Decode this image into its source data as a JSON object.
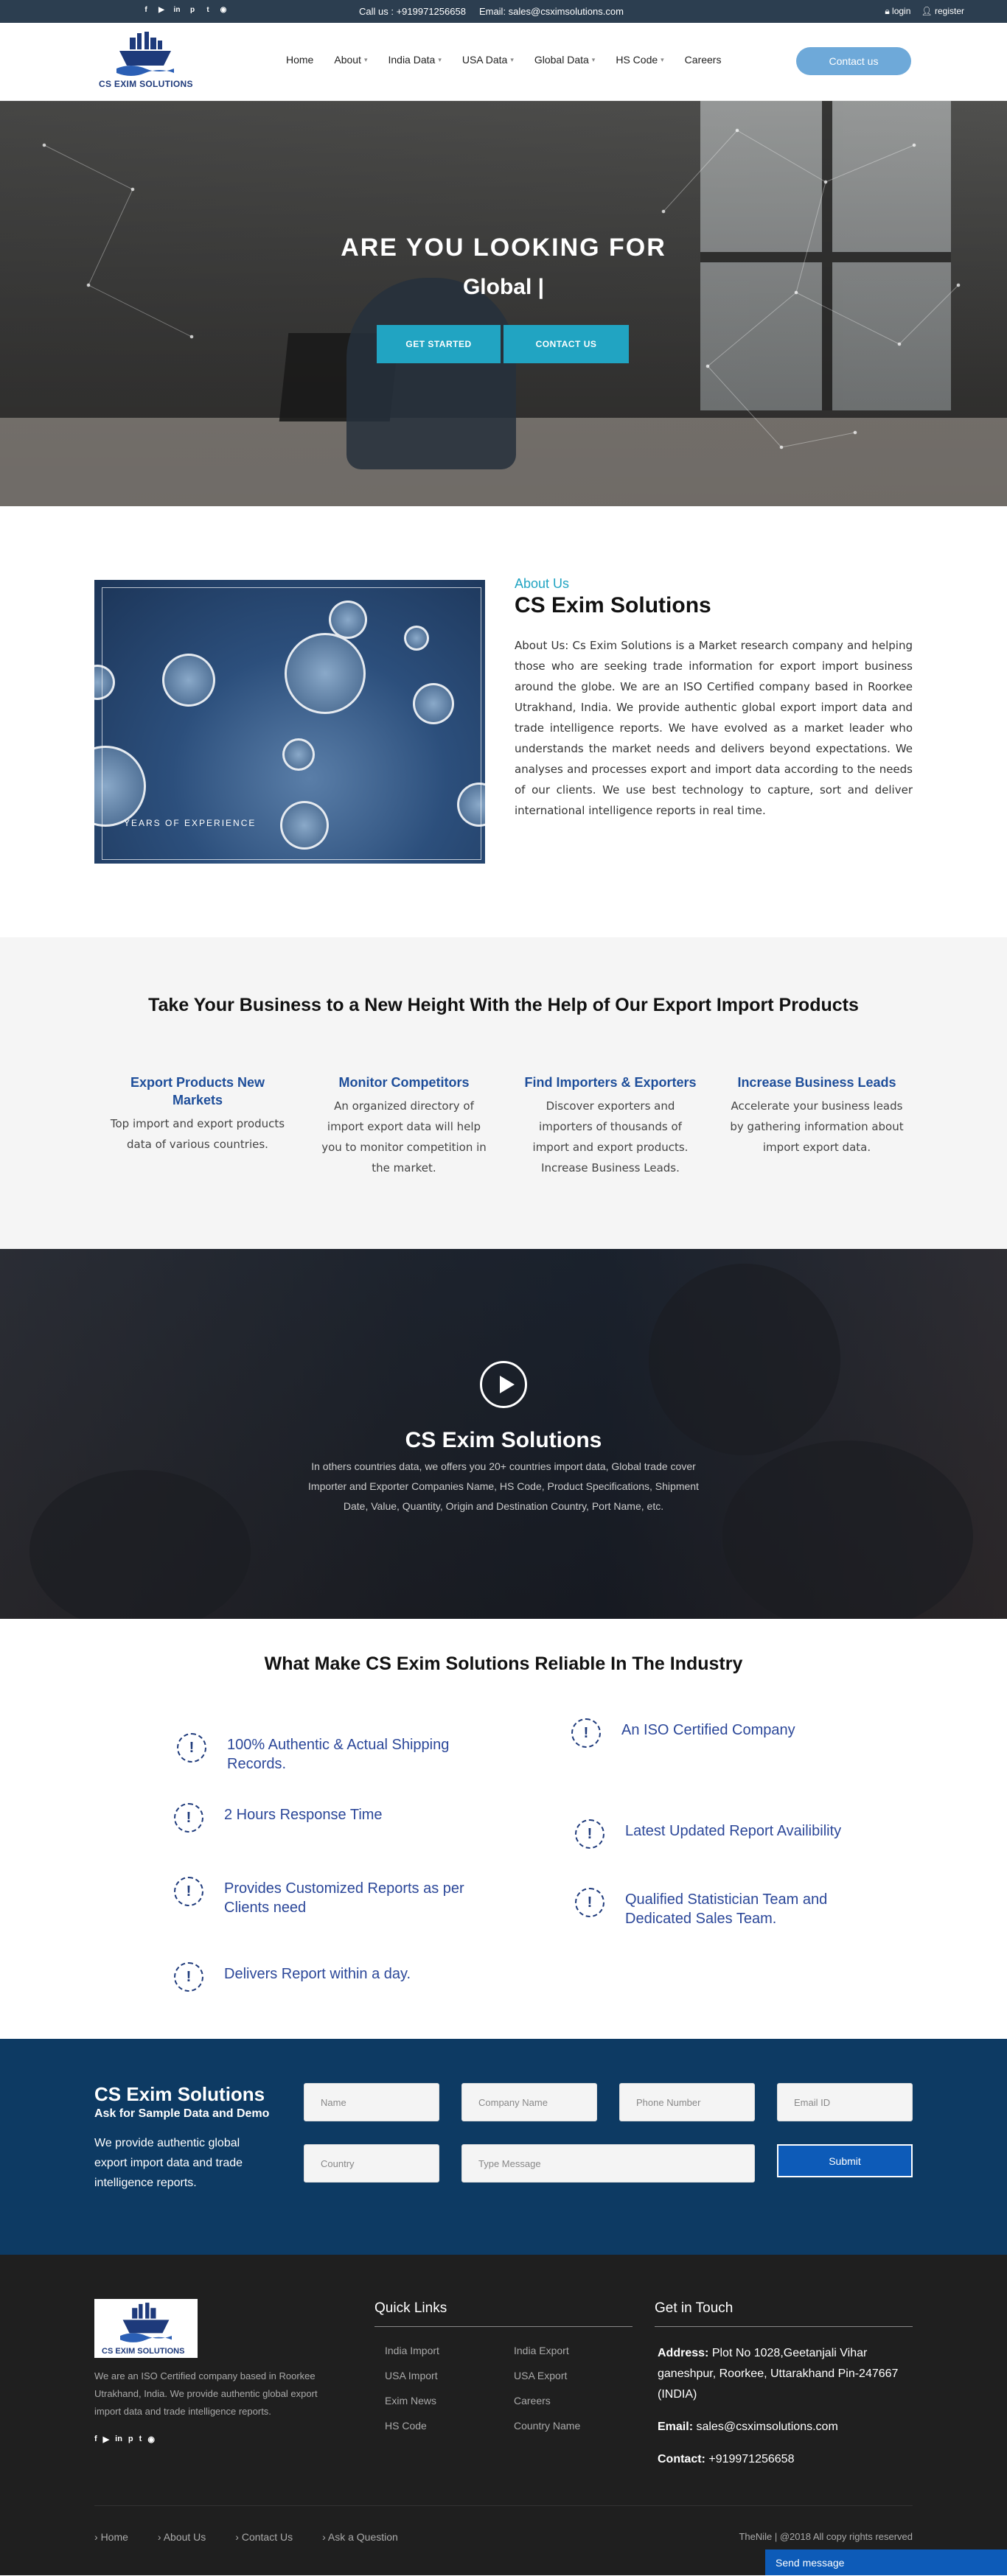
{
  "topbar": {
    "socials": [
      "facebook-icon",
      "youtube-icon",
      "linkedin-icon",
      "pinterest-icon",
      "twitter-icon",
      "rss-icon"
    ],
    "call": "Call us : +919971256658",
    "email": "Email: sales@csximsolutions.com",
    "login": "login",
    "register": "register"
  },
  "header": {
    "logo_text": "CS EXIM SOLUTIONS",
    "nav": [
      "Home",
      "About",
      "India Data",
      "USA Data",
      "Global Data",
      "HS Code",
      "Careers"
    ],
    "contact_button": "Contact us"
  },
  "hero": {
    "heading": "ARE YOU LOOKING FOR",
    "typed": "Global |",
    "get_started": "GET STARTED",
    "contact_us": "CONTACT US"
  },
  "about": {
    "label": "About Us",
    "title": "CS Exim Solutions",
    "image_caption": "YEARS OF EXPERIENCE",
    "text": "About Us: Cs Exim Solutions is a Market research company and helping those who are seeking trade information for export import business around the globe. We are an ISO Certified company based in Roorkee Utrakhand, India. We provide authentic global export import data and trade intelligence reports. We have evolved as a market leader who understands the market needs and delivers beyond expectations. We analyses and processes export and import data according to the needs of our clients. We use best technology to capture, sort and deliver international intelligence reports in real time."
  },
  "products": {
    "title": "Take Your Business to a New Height With the Help of Our Export Import Products",
    "items": [
      {
        "title": "Export Products New Markets",
        "text": "Top import and export products data of various countries."
      },
      {
        "title": "Monitor Competitors",
        "text": "An organized directory of import export data will help you to monitor competition in the market."
      },
      {
        "title": "Find Importers & Exporters",
        "text": "Discover exporters and importers of thousands of import and export products. Increase Business Leads."
      },
      {
        "title": "Increase Business Leads",
        "text": "Accelerate your business leads by gathering information about import export data."
      }
    ]
  },
  "video": {
    "title": "CS Exim Solutions",
    "text": "In others countries data, we offers you 20+ countries import data, Global trade cover Importer and Exporter Companies Name, HS Code, Product Specifications, Shipment Date, Value, Quantity, Origin and Destination Country, Port Name, etc."
  },
  "reliable": {
    "title": "What Make CS Exim Solutions Reliable In The Industry",
    "features": [
      "100% Authentic & Actual Shipping Records.",
      "An ISO Certified Company",
      "2 Hours Response Time",
      "Latest Updated Report Availibility",
      "Provides Customized Reports as per Clients need",
      "Qualified Statistician Team and Dedicated Sales Team.",
      "Delivers Report within a day."
    ]
  },
  "form": {
    "title": "CS Exim Solutions",
    "subtitle": "Ask for Sample Data and Demo",
    "text": "We provide authentic global export import data and trade intelligence reports.",
    "name": "Name",
    "company": "Company Name",
    "phone": "Phone Number",
    "email": "Email ID",
    "country": "Country",
    "message": "Type Message",
    "submit": "Submit"
  },
  "footer": {
    "desc": "We are an ISO Certified company based in Roorkee Utrakhand, India. We provide authentic global export import data and trade intelligence reports.",
    "quick_links_title": "Quick Links",
    "quick_links_left": [
      "India Import",
      "USA Import",
      "Exim News",
      "HS Code"
    ],
    "quick_links_right": [
      "India Export",
      "USA Export",
      "Careers",
      "Country Name"
    ],
    "get_in_touch_title": "Get in Touch",
    "address_label": "Address:",
    "address": "Plot No 1028,Geetanjali Vihar ganeshpur, Roorkee, Uttarakhand Pin-247667 (INDIA)",
    "email_label": "Email:",
    "email": "sales@csximsolutions.com",
    "contact_label": "Contact:",
    "contact": "+919971256658",
    "bottom_nav": [
      "Home",
      "About Us",
      "Contact Us",
      "Ask a Question"
    ],
    "copyright": "TheNile | @2018 All copy rights reserved",
    "send_message": "Send message"
  }
}
